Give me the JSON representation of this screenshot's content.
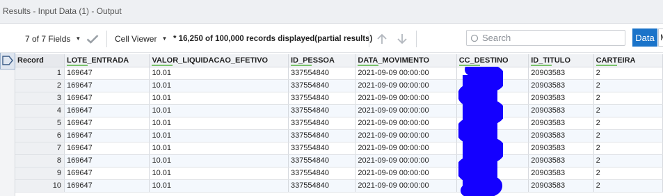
{
  "window": {
    "title": "Results - Input Data (1) - Output"
  },
  "toolbar": {
    "fields_label": "7 of 7 Fields",
    "viewer_label": "Cell Viewer",
    "records_info": "* 16,250 of 100,000 records displayed(partial results)",
    "data_label": "Data",
    "next_label": "M"
  },
  "search": {
    "placeholder": "Search"
  },
  "table": {
    "headers": [
      "Record",
      "LOTE_ENTRADA",
      "VALOR_LIQUIDACAO_EFETIVO",
      "ID_PESSOA",
      "DATA_MOVIMENTO",
      "CC_DESTINO",
      "ID_TITULO",
      "CARTEIRA"
    ],
    "rows": [
      [
        "1",
        "169647",
        "10.01",
        "337554840",
        "2021-09-09 00:00:00",
        "",
        "20903583",
        "2"
      ],
      [
        "2",
        "169647",
        "10.01",
        "337554840",
        "2021-09-09 00:00:00",
        "",
        "20903583",
        "2"
      ],
      [
        "3",
        "169647",
        "10.01",
        "337554840",
        "2021-09-09 00:00:00",
        "",
        "20903583",
        "2"
      ],
      [
        "4",
        "169647",
        "10.01",
        "337554840",
        "2021-09-09 00:00:00",
        "",
        "20903583",
        "2"
      ],
      [
        "5",
        "169647",
        "10.01",
        "337554840",
        "2021-09-09 00:00:00",
        "",
        "20903583",
        "2"
      ],
      [
        "6",
        "169647",
        "10.01",
        "337554840",
        "2021-09-09 00:00:00",
        "",
        "20903583",
        "2"
      ],
      [
        "7",
        "169647",
        "10.01",
        "337554840",
        "2021-09-09 00:00:00",
        "",
        "20903583",
        "2"
      ],
      [
        "8",
        "169647",
        "10.01",
        "337554840",
        "2021-09-09 00:00:00",
        "",
        "20903583",
        "2"
      ],
      [
        "9",
        "169647",
        "10.01",
        "337554840",
        "2021-09-09 00:00:00",
        "",
        "20903583",
        "2"
      ],
      [
        "10",
        "169647",
        "10.01",
        "337554840",
        "2021-09-09 00:00:00",
        "",
        "20903583",
        "2"
      ]
    ]
  },
  "colors": {
    "accent": "#1a73c9",
    "redaction": "#1400ff",
    "header_underline": "#7ac36a"
  }
}
